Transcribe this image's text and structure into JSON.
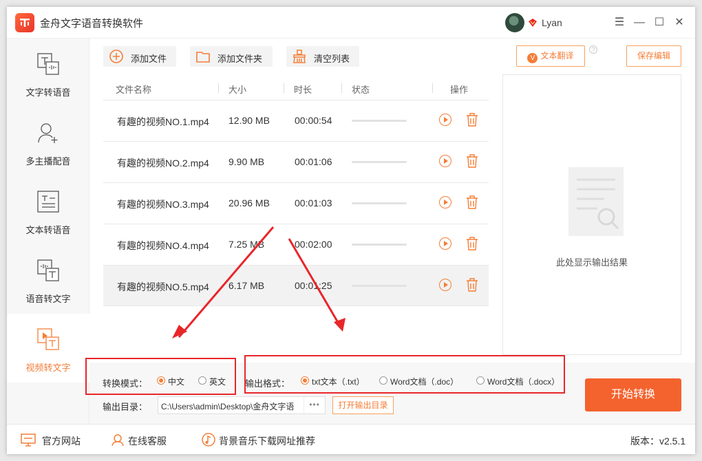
{
  "window": {
    "title": "金舟文字语音转换软件",
    "user": "Lyan"
  },
  "sidebar": {
    "items": [
      {
        "label": "文字转语音",
        "icon": "text-to-speech-icon"
      },
      {
        "label": "多主播配音",
        "icon": "multi-anchor-icon"
      },
      {
        "label": "文本转语音",
        "icon": "document-text-icon"
      },
      {
        "label": "语音转文字",
        "icon": "speech-to-text-icon"
      },
      {
        "label": "视频转文字",
        "icon": "video-to-text-icon",
        "active": true
      }
    ]
  },
  "toolbar": {
    "add_file": "添加文件",
    "add_folder": "添加文件夹",
    "clear_list": "清空列表",
    "translate": "文本翻译",
    "save_edit": "保存编辑"
  },
  "table": {
    "headers": [
      "文件名称",
      "大小",
      "时长",
      "状态",
      "操作"
    ],
    "rows": [
      {
        "name": "有趣的视频NO.1.mp4",
        "size": "12.90 MB",
        "duration": "00:00:54"
      },
      {
        "name": "有趣的视频NO.2.mp4",
        "size": "9.90 MB",
        "duration": "00:01:06"
      },
      {
        "name": "有趣的视频NO.3.mp4",
        "size": "20.96 MB",
        "duration": "00:01:03"
      },
      {
        "name": "有趣的视频NO.4.mp4",
        "size": "7.25 MB",
        "duration": "00:02:00"
      },
      {
        "name": "有趣的视频NO.5.mp4",
        "size": "6.17 MB",
        "duration": "00:01:25"
      }
    ]
  },
  "result": {
    "placeholder": "此处显示输出结果"
  },
  "settings": {
    "mode_label": "转换模式：",
    "mode_options": [
      "中文",
      "英文"
    ],
    "mode_selected": "中文",
    "format_label": "输出格式：",
    "format_options": [
      "txt文本（.txt）",
      "Word文档（.doc）",
      "Word文档（.docx）"
    ],
    "format_selected": "txt文本（.txt）",
    "dir_label": "输出目录：",
    "dir_value": "C:\\Users\\admin\\Desktop\\金舟文字语",
    "browse": "•••",
    "open_dir": "打开输出目录"
  },
  "start_button": "开始转换",
  "footer": {
    "website": "官方网站",
    "service": "在线客服",
    "music": "背景音乐下载网址推荐",
    "version": "版本：v2.5.1"
  },
  "colors": {
    "accent": "#f47e37",
    "start": "#f4622d",
    "annotation": "#e8262a"
  }
}
